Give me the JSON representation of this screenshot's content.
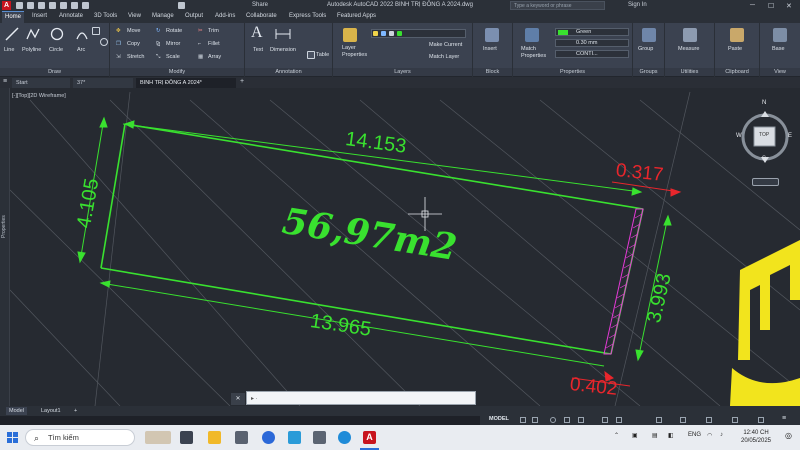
{
  "titlebar": {
    "share": "Share",
    "title": "Autodesk AutoCAD 2022   BINH TRỊ ĐÔNG A 2024.dwg",
    "search_placeholder": "Type a keyword or phrase",
    "signin": "Sign In"
  },
  "ribbon_tabs": [
    "Home",
    "Insert",
    "Annotate",
    "3D Tools",
    "View",
    "Manage",
    "Output",
    "Add-ins",
    "Collaborate",
    "Express Tools",
    "Featured Apps"
  ],
  "ribbon": {
    "draw": {
      "line": "Line",
      "polyline": "Polyline",
      "circle": "Circle",
      "arc": "Arc",
      "label": "Draw"
    },
    "modify": {
      "move": "Move",
      "rotate": "Rotate",
      "trim": "Trim",
      "copy": "Copy",
      "mirror": "Mirror",
      "fillet": "Fillet",
      "stretch": "Stretch",
      "scale": "Scale",
      "array": "Array",
      "label": "Modify"
    },
    "annotation": {
      "text": "Text",
      "dimension": "Dimension",
      "table": "Table",
      "label": "Annotation"
    },
    "layers": {
      "layer_properties": "Layer Properties",
      "make_current": "Make Current",
      "match_layer": "Match Layer",
      "label": "Layers"
    },
    "block": {
      "insert": "Insert",
      "label": "Block"
    },
    "properties": {
      "match": "Match Properties",
      "color": "Green",
      "lineweight": "0.30 mm",
      "linetype": "CONTI...",
      "label": "Properties"
    },
    "groups": {
      "group": "Group",
      "label": "Groups"
    },
    "utilities": {
      "measure": "Measure",
      "label": "Utilities"
    },
    "clipboard": {
      "paste": "Paste",
      "label": "Clipboard"
    },
    "view": {
      "base": "Base",
      "label": "View"
    }
  },
  "file_tabs": {
    "start": "Start",
    "tab2": "37*",
    "tab3": "BINH TRỊ ĐÔNG A 2024*"
  },
  "viewport_label": "[-][Top][2D Wireframe]",
  "side_panel": "Properties",
  "viewcube": {
    "top": "TOP",
    "n": "N",
    "s": "S",
    "e": "E",
    "w": "W"
  },
  "drawing": {
    "area": "56,97m2",
    "dim_top": "14.153",
    "dim_bottom": "13.965",
    "dim_left": "4.105",
    "dim_right": "3.993",
    "dim_red_top": "0.317",
    "dim_red_bottom": "0.402"
  },
  "command_line": {
    "close": "✕",
    "placeholder": "▸ ·"
  },
  "layout_tabs": [
    "Model",
    "Layout1",
    "+"
  ],
  "status": {
    "model": "MODEL"
  },
  "taskbar": {
    "search": "Tìm kiếm",
    "lang": "ENG",
    "time": "12:40 CH",
    "date": "20/05/2025"
  },
  "colors": {
    "green": "#39e12f",
    "red": "#e8262c",
    "magenta": "#e43ad6",
    "yellow": "#f2e41d",
    "bg": "#262a31"
  }
}
